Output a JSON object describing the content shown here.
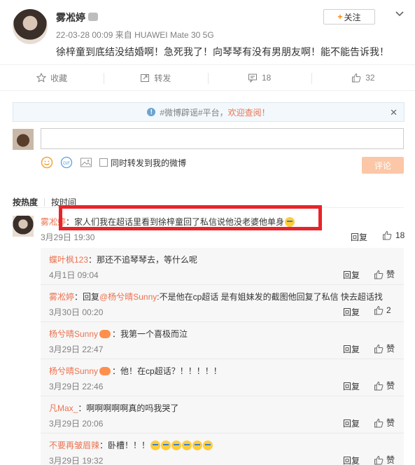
{
  "post": {
    "username": "雾凇婷",
    "meta": "22-03-28 00:09 来自 HUAWEI Mate 30 5G",
    "content": "徐梓童到底结没结婚啊！急死我了！向琴琴有没有男朋友啊！能不能告诉我！",
    "follow_label": "关注"
  },
  "actions": [
    {
      "label": "收藏",
      "icon": "star-icon"
    },
    {
      "label": "转发",
      "icon": "repost-icon"
    },
    {
      "label": "18",
      "icon": "comment-icon"
    },
    {
      "label": "32",
      "icon": "like-icon"
    }
  ],
  "notice": {
    "text": "#微博辟谣#平台，",
    "link": "欢迎查阅！"
  },
  "composer": {
    "placeholder": "",
    "repost_label": "同时转发到我的微博",
    "submit_label": "评论"
  },
  "sort": {
    "hot": "按热度",
    "time": "按时间"
  },
  "top_comment": {
    "username": "雾凇婷",
    "text": "：家人们我在超话里看到徐梓童回了私信说他没老婆他单身",
    "date": "3月29日 19:30",
    "reply_label": "回复",
    "likes": "18"
  },
  "replies": [
    {
      "username": "蝶叶枫123",
      "mention": "",
      "text": "：那还不追琴琴去，等什么呢",
      "date": "4月1日 09:04",
      "reply_label": "回复",
      "likes": "赞",
      "badge": false,
      "emojis": 0
    },
    {
      "username": "雾凇婷",
      "mention": "@杨兮晴Sunny",
      "prefix": "：回复",
      "text": ":不是他在cp超话 是有姐妹发的截图他回复了私信 快去超话找",
      "date": "3月30日 00:20",
      "reply_label": "回复",
      "likes": "2",
      "badge": false,
      "emojis": 0
    },
    {
      "username": "杨兮晴Sunny",
      "mention": "",
      "text": "：我第一个喜极而泣",
      "date": "3月29日 22:47",
      "reply_label": "回复",
      "likes": "赞",
      "badge": true,
      "emojis": 0
    },
    {
      "username": "杨兮晴Sunny",
      "mention": "",
      "text": "：他！在cp超话？！！！！！",
      "date": "3月29日 22:46",
      "reply_label": "回复",
      "likes": "赞",
      "badge": true,
      "emojis": 0
    },
    {
      "username": "凡Max_",
      "mention": "",
      "text": "：啊啊啊啊啊真的吗我哭了",
      "date": "3月29日 20:06",
      "reply_label": "回复",
      "likes": "赞",
      "badge": false,
      "emojis": 0
    },
    {
      "username": "不要再皱眉辣",
      "mention": "",
      "text": "：卧槽！！！",
      "date": "3月29日 19:32",
      "reply_label": "回复",
      "likes": "赞",
      "badge": false,
      "emojis": 6
    }
  ],
  "colors": {
    "accent": "#eb7350",
    "follow_plus": "#ff8200",
    "highlight_box": "#e8242a",
    "submit_disabled": "#fbc7a6"
  }
}
